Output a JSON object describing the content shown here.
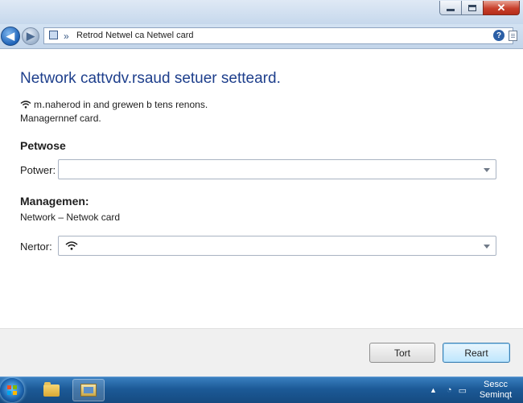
{
  "window": {
    "caption_buttons": {
      "minimize_icon": "minimize-icon",
      "maximize_icon": "maximize-icon",
      "close_icon": "close-icon"
    }
  },
  "address_bar": {
    "separator": "»",
    "path": "Retrod Netwel ca Netwel card",
    "help_glyph": "?"
  },
  "page": {
    "title": "Network cattvdv.rsaud setuer setteard.",
    "description_line1": "m․naherod in  and grewen b tens renons.",
    "description_line2": "Managernnef card.",
    "section1": {
      "heading": "Petwose",
      "field_label": "Potwer:",
      "field_value": ""
    },
    "section2": {
      "heading": "Managemen:",
      "subtitle": "Network  –  Netwok card",
      "field_label": "Nertor:",
      "field_value": ""
    }
  },
  "footer": {
    "tort_label": "Tort",
    "reart_label": "Reart"
  },
  "taskbar": {
    "clock_line1": "Sesсс",
    "clock_line2": "Seminqt",
    "tray_up": "▲",
    "tray_icon1": "◔",
    "tray_icon2": "▭"
  },
  "colors": {
    "title_blue": "#1e3f8c",
    "taskbar_blue": "#1c5a97",
    "default_button_border": "#3c7fb1"
  }
}
